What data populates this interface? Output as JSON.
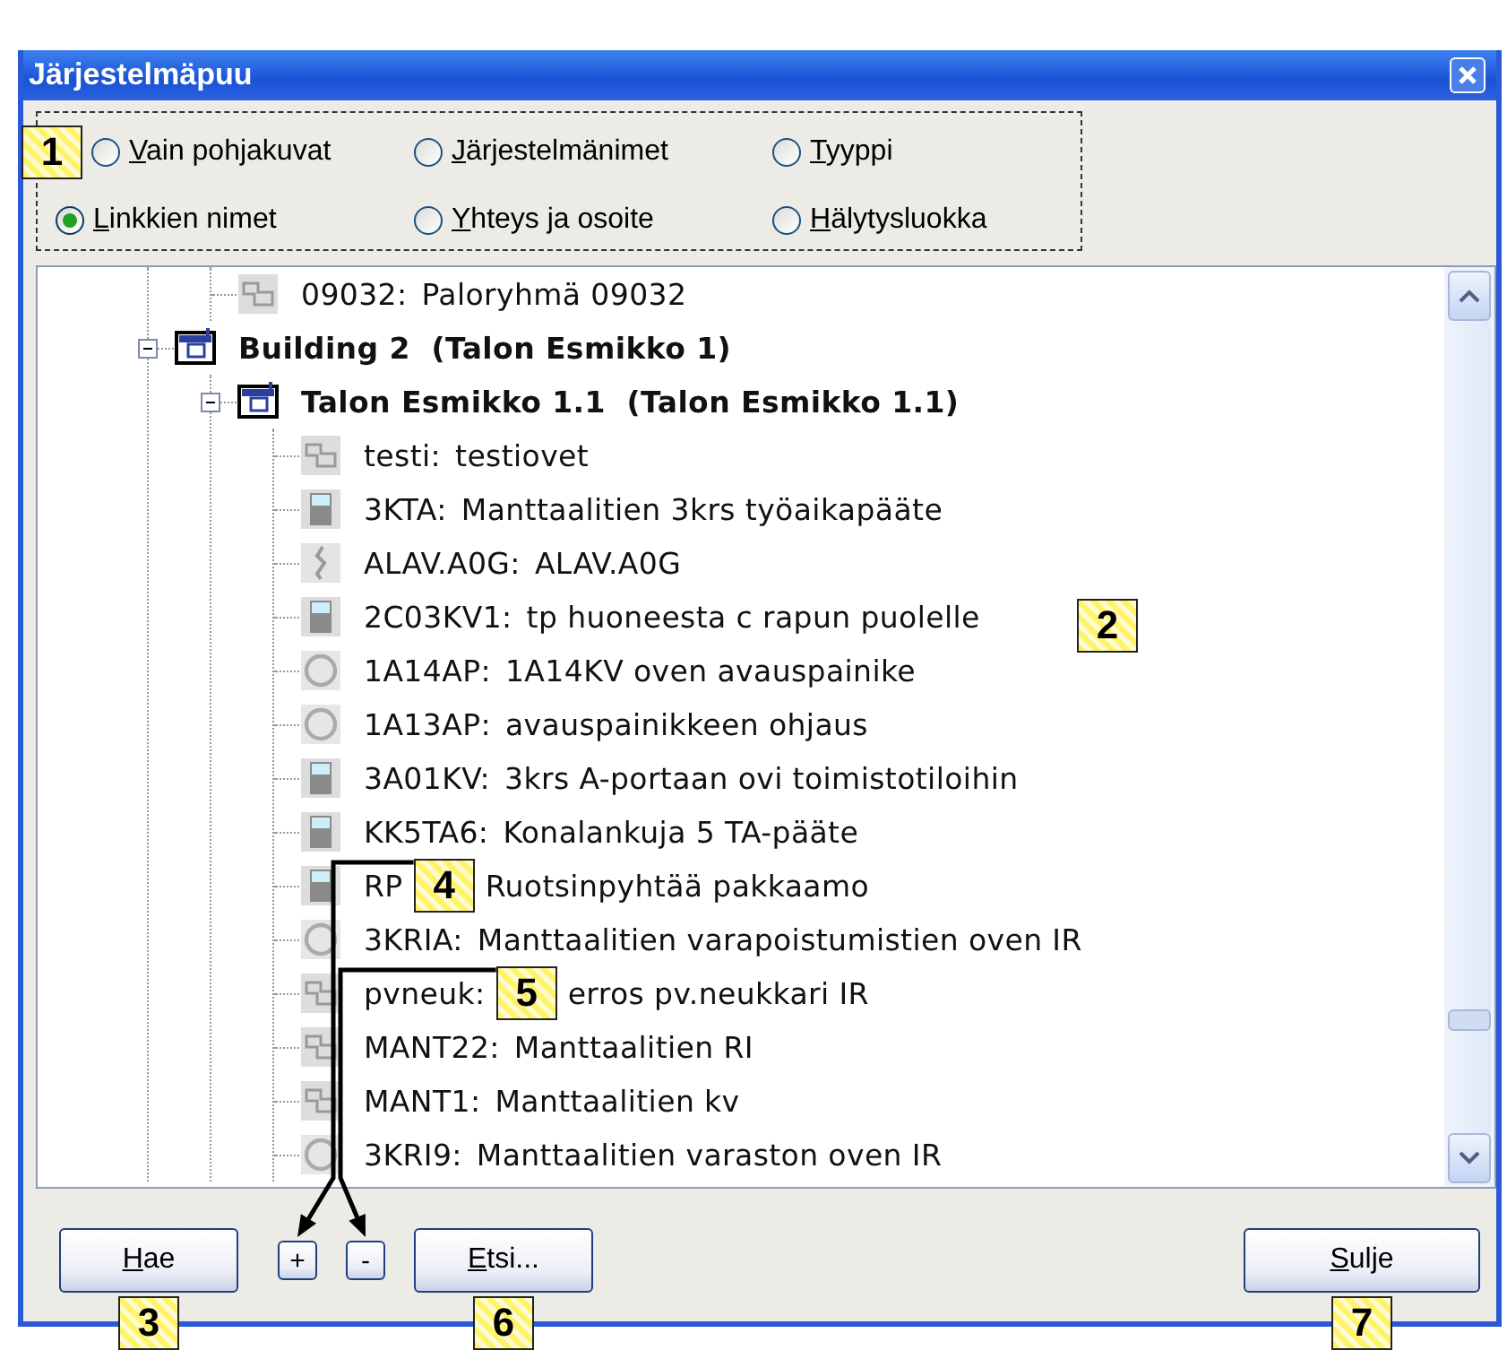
{
  "window": {
    "title": "Järjestelmäpuu"
  },
  "options": [
    {
      "label": "Vain pohjakuvat",
      "selected": false,
      "callout": "1"
    },
    {
      "label": "Järjestelmänimet",
      "selected": false
    },
    {
      "label": "Tyyppi",
      "selected": false
    },
    {
      "label": "Linkkien nimet",
      "selected": true
    },
    {
      "label": "Yhteys ja osoite",
      "selected": false
    },
    {
      "label": "Hälytysluokka",
      "selected": false
    }
  ],
  "tree": {
    "callout": "2",
    "items": [
      {
        "children": [
          {
            "code": "09032:",
            "name": "Paloryhmä 09032",
            "kind": "group"
          }
        ]
      },
      {
        "label": "Building 2  (Talon Esmikko 1)",
        "kind": "building",
        "expanded": true,
        "children": [
          {
            "label": "Talon Esmikko 1.1  (Talon Esmikko 1.1)",
            "kind": "building",
            "expanded": true,
            "children": [
              {
                "code": "testi:",
                "name": "testiovet",
                "kind": "group"
              },
              {
                "code": "3KTA:",
                "name": "Manttaalitien 3krs työaikapääte",
                "kind": "terminal"
              },
              {
                "code": "ALAV.A0G:",
                "name": "ALAV.A0G",
                "kind": "sensor"
              },
              {
                "code": "2C03KV1:",
                "name": "tp huoneesta c rapun puolelle",
                "kind": "terminal"
              },
              {
                "code": "1A14AP:",
                "name": "1A14KV oven avauspainike",
                "kind": "button"
              },
              {
                "code": "1A13AP:",
                "name": "avauspainikkeen ohjaus",
                "kind": "button"
              },
              {
                "code": "3A01KV:",
                "name": "3krs A-portaan ovi toimistotiloihin",
                "kind": "terminal"
              },
              {
                "code": "KK5TA6:",
                "name": "Konalankuja 5 TA-pääte",
                "kind": "terminal"
              },
              {
                "code": "RP",
                "name": "Ruotsinpyhtää pakkaamo",
                "kind": "terminal",
                "callout": "4"
              },
              {
                "code": "3KRIA:",
                "name": "Manttaalitien varapoistumistien oven IR",
                "kind": "button"
              },
              {
                "code": "pvneuk:",
                "name": "erros pv.neukkari IR",
                "kind": "group",
                "callout": "5"
              },
              {
                "code": "MANT22:",
                "name": "Manttaalitien RI",
                "kind": "group"
              },
              {
                "code": "MANT1:",
                "name": "Manttaalitien kv",
                "kind": "group"
              },
              {
                "code": "3KRI9:",
                "name": "Manttaalitien varaston oven IR",
                "kind": "button"
              }
            ]
          }
        ]
      }
    ]
  },
  "buttons": [
    {
      "label": "Hae",
      "kind": "text",
      "callout": "3"
    },
    {
      "label": "+",
      "kind": "small"
    },
    {
      "label": "-",
      "kind": "small"
    },
    {
      "label": "Etsi...",
      "kind": "text",
      "callout": "6"
    },
    {
      "label": "Sulje",
      "kind": "text",
      "callout": "7"
    }
  ]
}
